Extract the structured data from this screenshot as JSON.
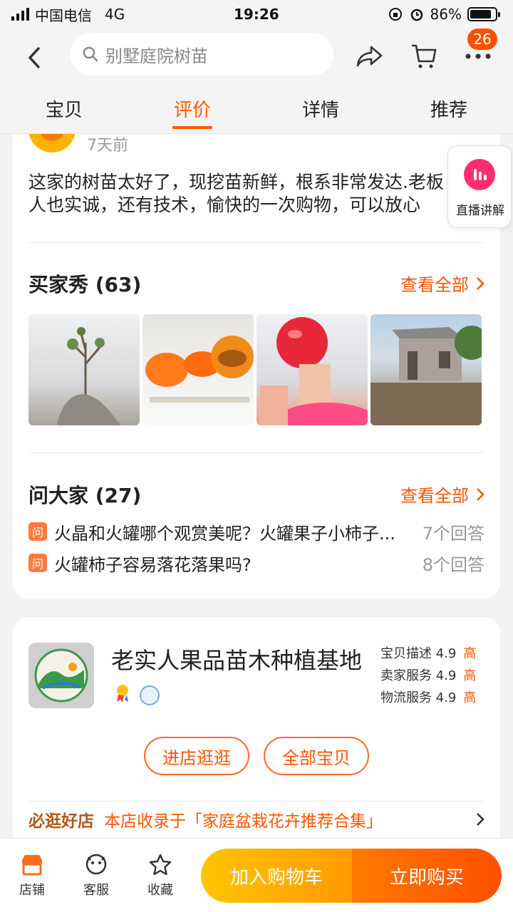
{
  "status_bar": {
    "carrier": "中国电信",
    "network": "4G",
    "time": "19:26",
    "battery": "86%",
    "battery_level": 0.86
  },
  "header": {
    "search_placeholder": "别墅庭院树苗",
    "cart_badge": "26"
  },
  "tabs": [
    {
      "label": "宝贝"
    },
    {
      "label": "评价",
      "active": true
    },
    {
      "label": "详情"
    },
    {
      "label": "推荐"
    }
  ],
  "review": {
    "time": "7天前",
    "text_line1": "这家的树苗太好了，现挖苗新鲜，根系非常发达.老板",
    "text_line2": "人也实诚，还有技术，愉快的一次购物，可以放心"
  },
  "live": {
    "label": "直播讲解"
  },
  "buyer_show": {
    "title": "买家秀 (63)",
    "see_all": "查看全部"
  },
  "qa": {
    "title": "问大家 (27)",
    "see_all": "查看全部",
    "icon_label": "问",
    "items": [
      {
        "question": "火晶和火罐哪个观赏美呢？火罐果子小柿子...",
        "answers": "7个回答"
      },
      {
        "question": "火罐柿子容易落花落果吗?",
        "answers": "8个回答"
      }
    ]
  },
  "shop": {
    "name": "老实人果品苗木种植基地",
    "ratings": [
      {
        "label": "宝贝描述",
        "score": "4.9",
        "level": "高"
      },
      {
        "label": "卖家服务",
        "score": "4.9",
        "level": "高"
      },
      {
        "label": "物流服务",
        "score": "4.9",
        "level": "高"
      }
    ],
    "enter_button": "进店逛逛",
    "all_items_button": "全部宝贝",
    "promo_tag": "必逛好店",
    "promo_text": "本店收录于「家庭盆栽花卉推荐合集」"
  },
  "bottom_bar": {
    "shop": "店铺",
    "service": "客服",
    "favorite": "收藏",
    "add_to_cart": "加入购物车",
    "buy_now": "立即购买"
  },
  "colors": {
    "accent": "#ff5500",
    "cart_gradient": "#ffc500",
    "buy_gradient": "#ff4f00"
  }
}
